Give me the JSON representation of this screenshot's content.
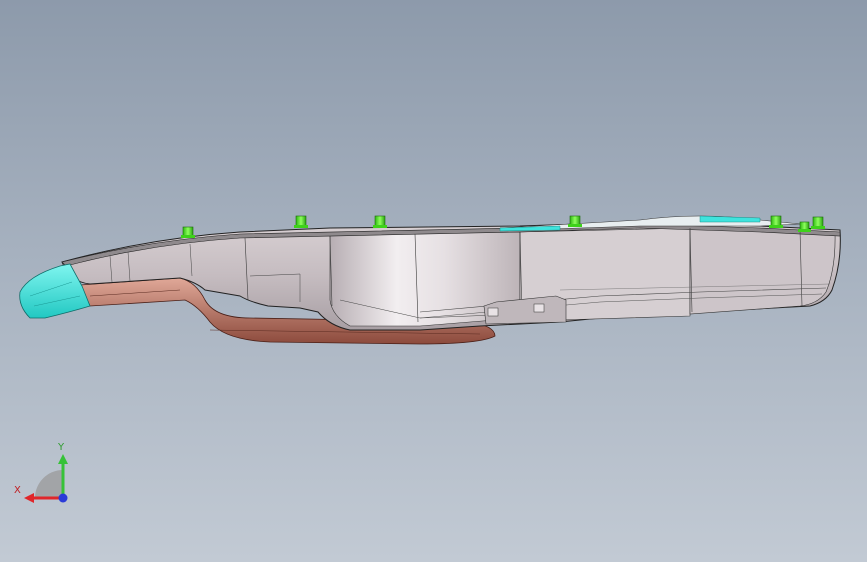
{
  "viewport": {
    "background_top": "#8d9aab",
    "background_bottom": "#c2cad4"
  },
  "model": {
    "body_color": "#c9c1c5",
    "edge_color": "#2a2a2a",
    "cyan_part_color": "#3fe3dd",
    "copper_part_color": "#b86f5f",
    "stud_color": "#39e31a",
    "stud_count": 7
  },
  "triad": {
    "x_label": "X",
    "y_label": "Y",
    "x_color": "#e0262a",
    "y_color": "#36c238",
    "z_color": "#2a3bd8",
    "x_icon": "x-axis-arrow",
    "y_icon": "y-axis-arrow",
    "z_icon": "z-axis-dot"
  }
}
